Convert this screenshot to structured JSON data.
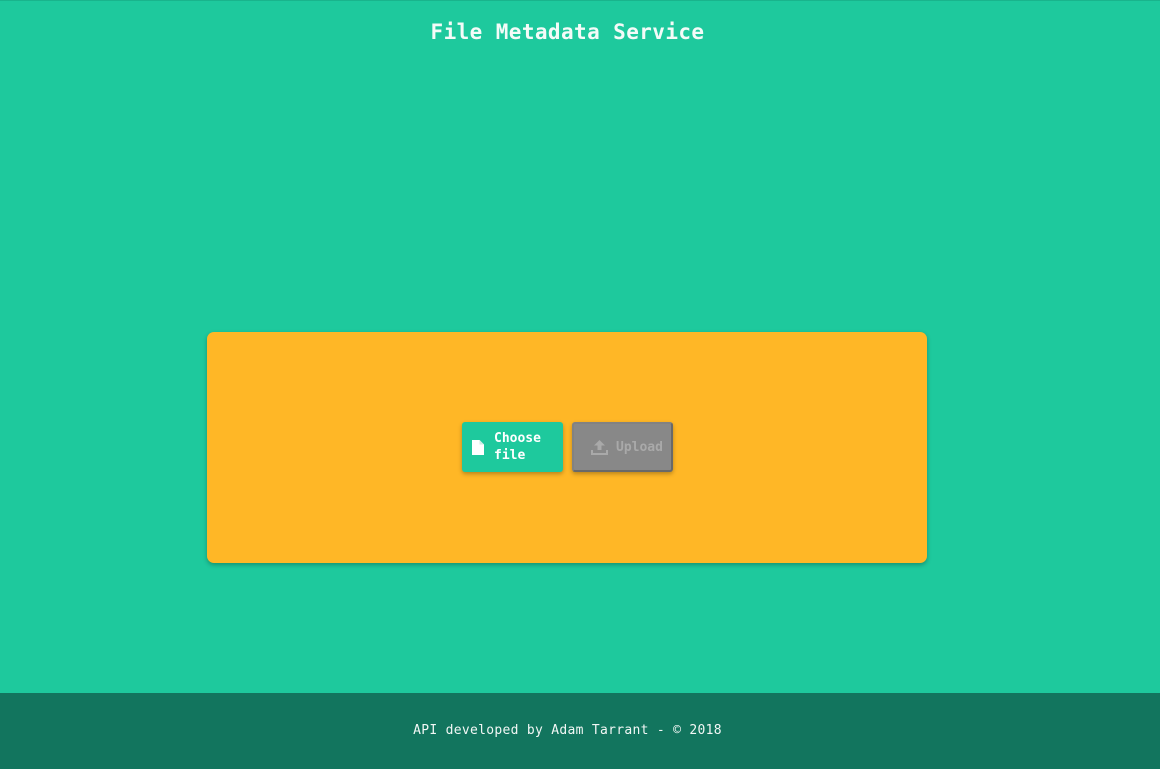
{
  "header": {
    "title": "File Metadata Service"
  },
  "upload_panel": {
    "choose_button": {
      "label": "Choose file",
      "icon": "file-icon"
    },
    "upload_button": {
      "label": "Upload",
      "icon": "upload-icon",
      "enabled": false
    }
  },
  "footer": {
    "text": "API developed by Adam Tarrant - © 2018"
  },
  "colors": {
    "background": "#1ec99d",
    "card": "#ffb726",
    "footer": "#12755e",
    "disabled_button": "#888888"
  }
}
